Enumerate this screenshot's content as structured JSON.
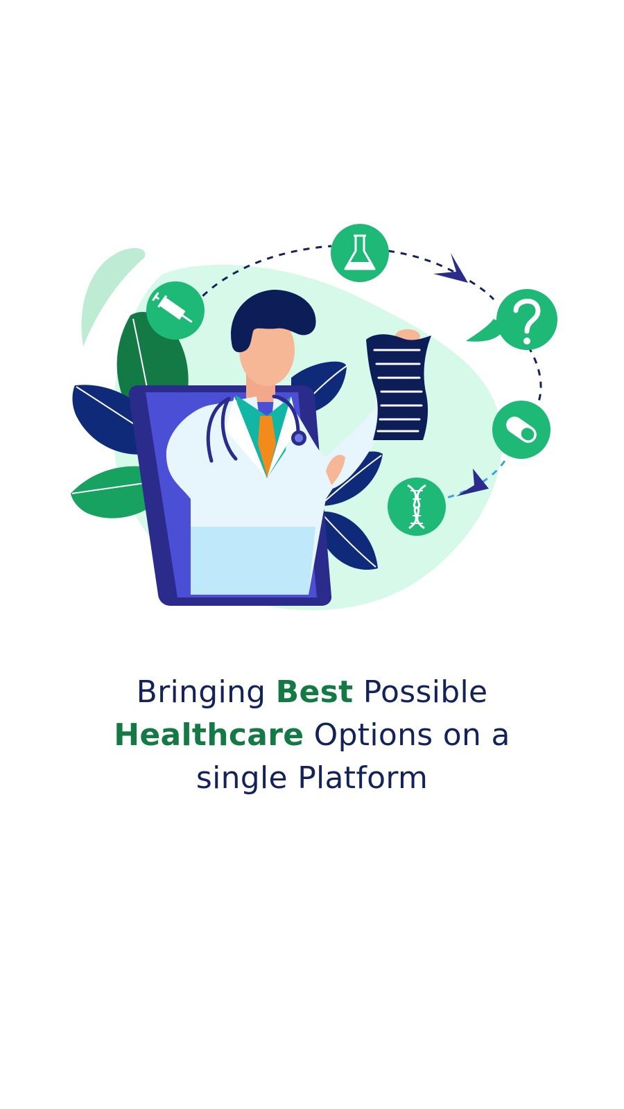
{
  "colors": {
    "background": "#ffffff",
    "text_primary": "#14225a",
    "text_highlight": "#137a45",
    "icon_green": "#1eb877",
    "blob_mint": "#d7f9ea",
    "leaf_dark_blue": "#0f2a78",
    "leaf_green": "#17a262",
    "device_purple": "#3b3bb5"
  },
  "illustration": {
    "icons": [
      "syringe-icon",
      "flask-icon",
      "question-mark-icon",
      "capsule-icon",
      "dna-icon"
    ]
  },
  "headline": {
    "line1_prefix": "Bringing ",
    "line1_highlight": "Best",
    "line1_suffix": " Possible",
    "line2_highlight": "Healthcare",
    "line2_suffix": " Options on a",
    "line3": "single Platform"
  }
}
